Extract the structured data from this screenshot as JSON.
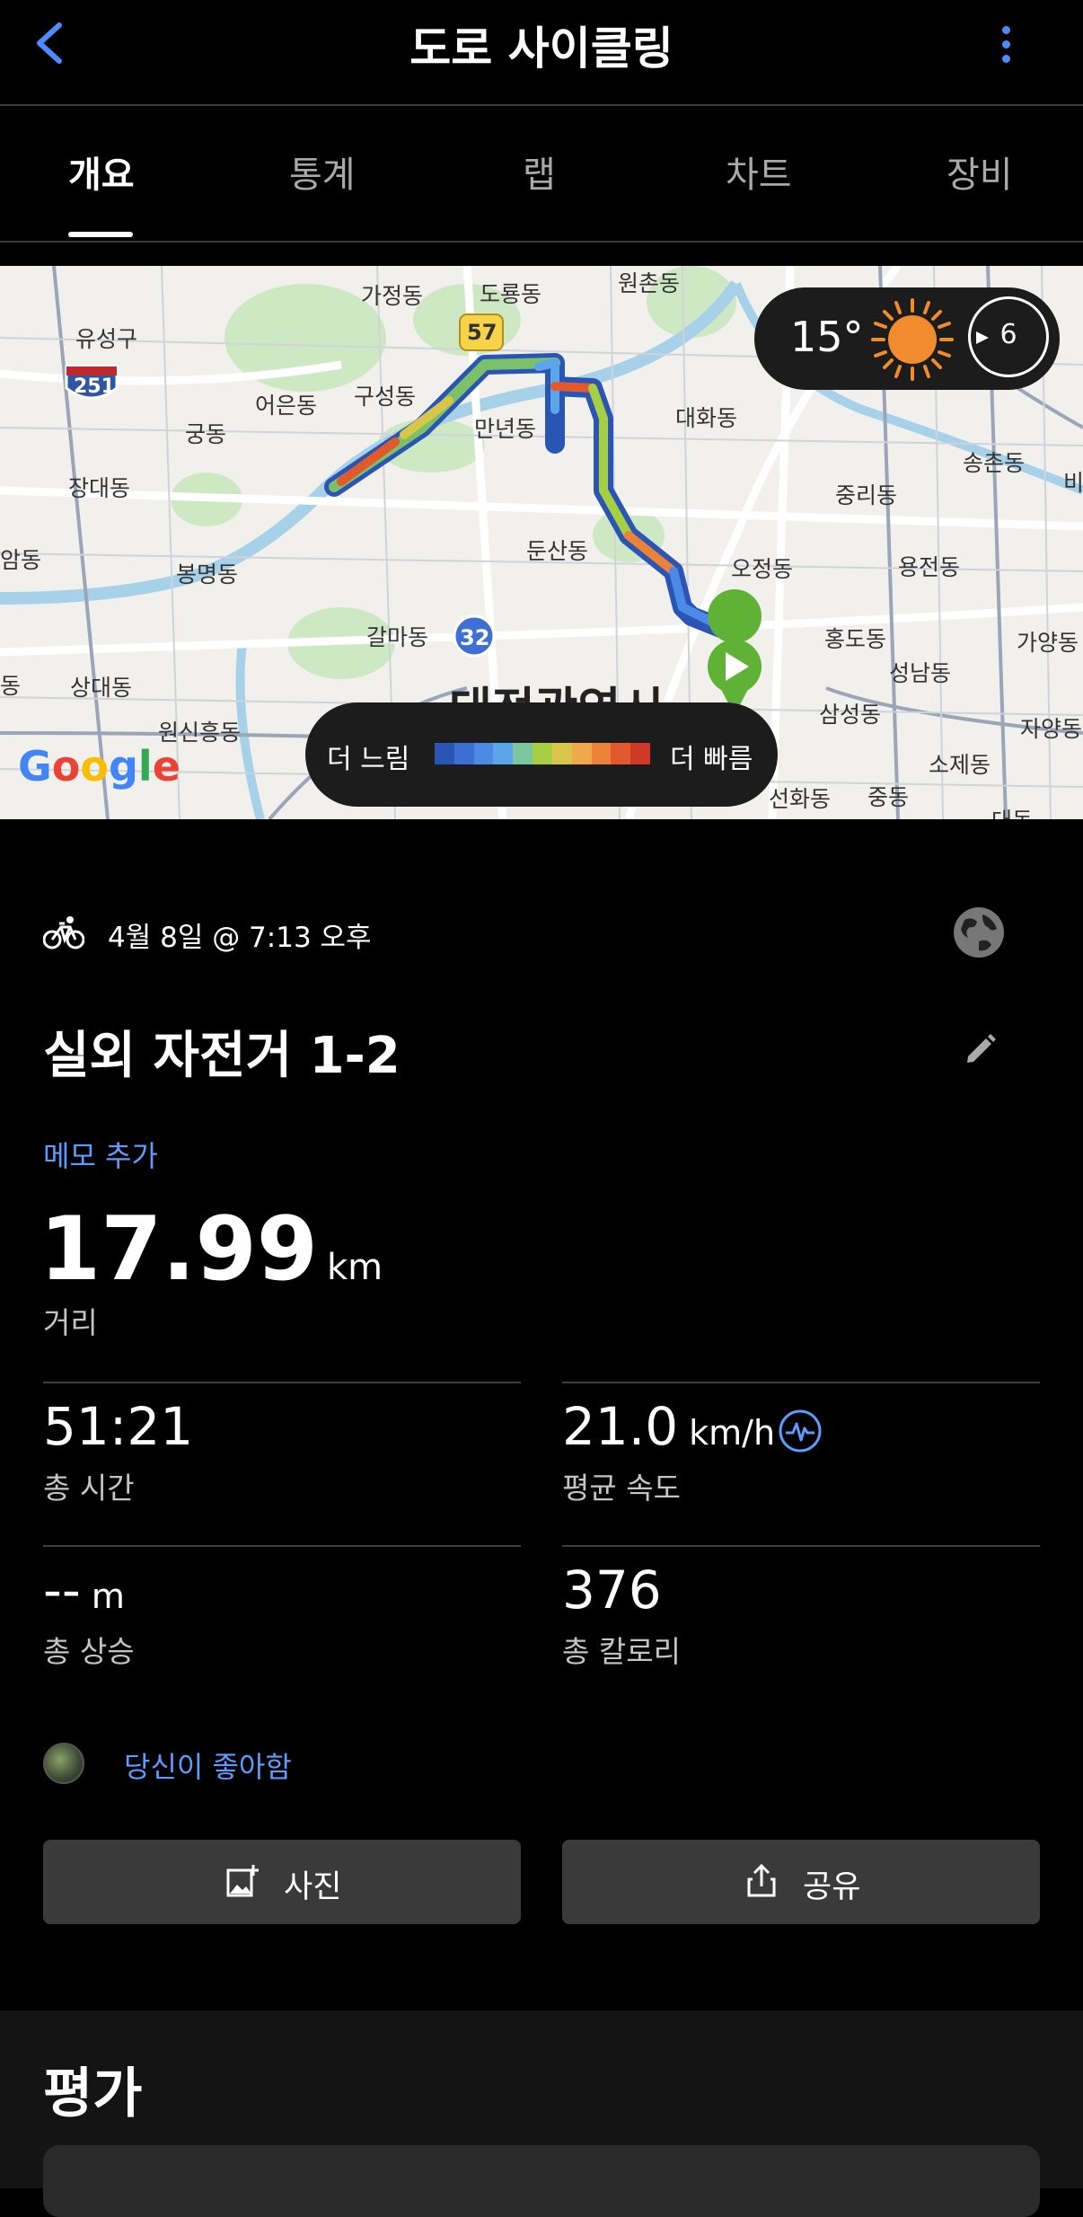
{
  "header": {
    "title": "도로 사이클링"
  },
  "tabs": [
    {
      "label": "개요",
      "active": true
    },
    {
      "label": "통계",
      "active": false
    },
    {
      "label": "랩",
      "active": false
    },
    {
      "label": "차트",
      "active": false
    },
    {
      "label": "장비",
      "active": false
    }
  ],
  "map": {
    "labels": [
      "원촌동",
      "가정동",
      "도룡동",
      "유성구",
      "251",
      "57",
      "어은동",
      "구성동",
      "만년동",
      "궁동",
      "대화동",
      "송촌동",
      "장대동",
      "중리동",
      "비",
      "둔산동",
      "암동",
      "봉명동",
      "오정동",
      "용전동",
      "갈마동",
      "32",
      "홍도동",
      "가양동",
      "성남동",
      "동",
      "상대동",
      "삼성동",
      "원신흥동",
      "자양동",
      "소제동",
      "선화동",
      "중동",
      "대동"
    ],
    "city_label": "대전광역시",
    "weather": {
      "temperature": "15°",
      "wind": "6",
      "icon": "sun-icon"
    },
    "legend": {
      "slow": "더 느림",
      "fast": "더 빠름",
      "colors": [
        "#2a55b4",
        "#3b6fd4",
        "#4c8ae6",
        "#5ba6ea",
        "#7cc6a1",
        "#a6cf43",
        "#d8c64a",
        "#f0a94a",
        "#ec8238",
        "#e25a2c",
        "#cf3a28"
      ]
    },
    "attribution": "Google"
  },
  "activity": {
    "datetime": "4월 8일 @ 7:13 오후",
    "name": "실외 자전거 1-2",
    "memo_link": "메모 추가",
    "distance": {
      "value": "17.99",
      "unit": "km",
      "label": "거리"
    },
    "stats": [
      {
        "value": "51:21",
        "unit": "",
        "label": "총 시간"
      },
      {
        "value": "21.0",
        "unit": "km/h",
        "label": "평균 속도"
      },
      {
        "value": "--",
        "unit": "m",
        "label": "총 상승"
      },
      {
        "value": "376",
        "unit": "",
        "label": "총 칼로리"
      }
    ],
    "likes_text": "당신이 좋아함"
  },
  "actions": {
    "photo": "사진",
    "share": "공유"
  },
  "rating": {
    "title": "평가"
  },
  "colors": {
    "accent": "#5e9bff",
    "background": "#000000",
    "button": "#3a3a3a"
  }
}
